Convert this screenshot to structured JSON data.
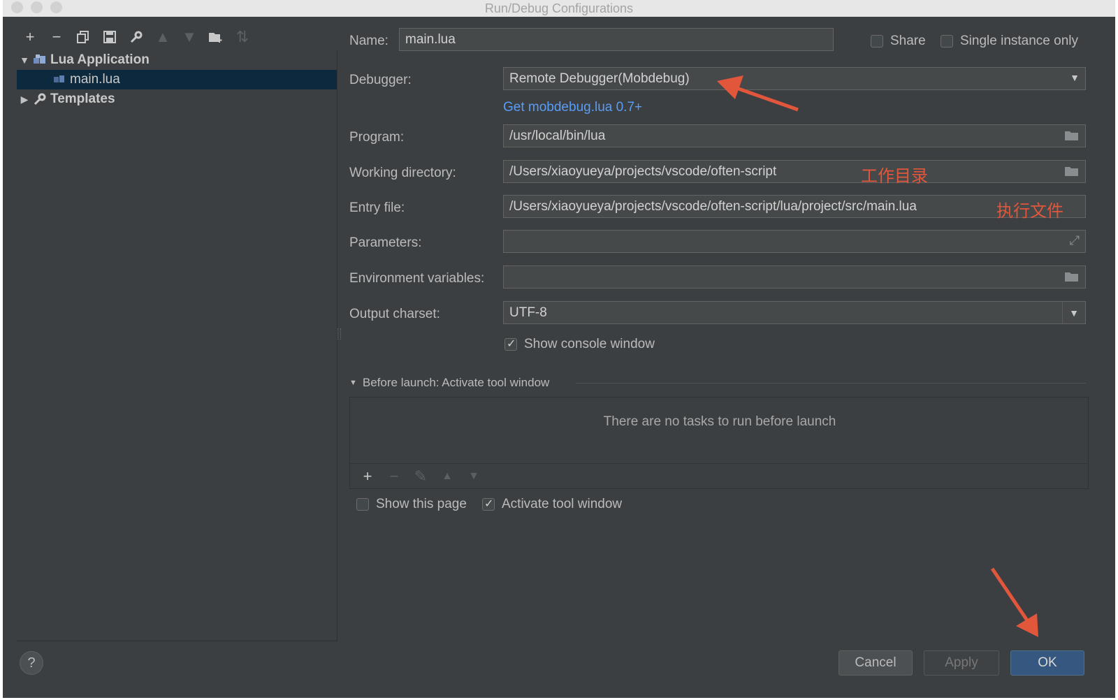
{
  "window": {
    "title": "Run/Debug Configurations"
  },
  "toolbar": {
    "icons": [
      "add-icon",
      "remove-icon",
      "copy-icon",
      "save-icon",
      "wrench-icon",
      "move-up-icon",
      "move-down-icon",
      "folder-add-icon",
      "sort-icon"
    ]
  },
  "tree": {
    "group": "Lua Application",
    "item": "main.lua",
    "templates": "Templates"
  },
  "form": {
    "name_label": "Name:",
    "name_value": "main.lua",
    "share_label": "Share",
    "single_instance_label": "Single instance only",
    "debugger_label": "Debugger:",
    "debugger_value": "Remote Debugger(Mobdebug)",
    "mobdebug_link": "Get mobdebug.lua 0.7+",
    "program_label": "Program:",
    "program_value": "/usr/local/bin/lua",
    "workdir_label": "Working directory:",
    "workdir_value": "/Users/xiaoyueya/projects/vscode/often-script",
    "workdir_note": "工作目录",
    "entry_label": "Entry file:",
    "entry_value": "/Users/xiaoyueya/projects/vscode/often-script/lua/project/src/main.lua",
    "entry_note": "执行文件",
    "params_label": "Parameters:",
    "params_value": "",
    "env_label": "Environment variables:",
    "env_value": "",
    "charset_label": "Output charset:",
    "charset_value": "UTF-8",
    "show_console_label": "Show console window"
  },
  "before_launch": {
    "header": "Before launch: Activate tool window",
    "empty_text": "There are no tasks to run before launch",
    "show_page_label": "Show this page",
    "activate_label": "Activate tool window"
  },
  "buttons": {
    "help": "?",
    "cancel": "Cancel",
    "apply": "Apply",
    "ok": "OK"
  },
  "colors": {
    "background": "#3c3f41",
    "selection": "#0d293e",
    "link": "#589df6",
    "annotation": "#e2563b",
    "primary": "#365880"
  }
}
